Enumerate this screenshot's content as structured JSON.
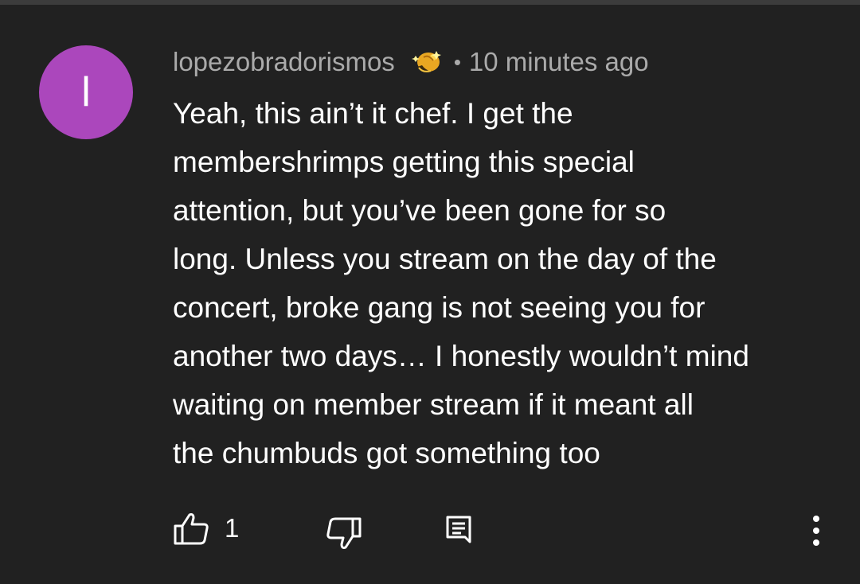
{
  "comment": {
    "avatar_letter": "l",
    "avatar_color": "#ab47bc",
    "username": "lopezobradorismos",
    "badge_icon": "membership-badge-shrimp-icon",
    "separator": "•",
    "timestamp": "10 minutes ago",
    "body_lines": [
      "Yeah, this ain’t it chef. I get the",
      "membershrimps getting this special",
      "attention, but you’ve been gone for so",
      "long. Unless you stream on the day of the",
      "concert, broke gang is not seeing you for",
      "another two days… I honestly wouldn’t mind",
      "waiting on member stream if it meant all",
      "the chumbuds got something too"
    ]
  },
  "actions": {
    "like_icon": "thumbs-up-icon",
    "like_count": "1",
    "dislike_icon": "thumbs-down-icon",
    "reply_icon": "reply-comment-icon",
    "more_icon": "more-vertical-icon"
  },
  "colors": {
    "background": "#212121",
    "text_primary": "#ffffff",
    "text_secondary": "#aaaaaa"
  }
}
